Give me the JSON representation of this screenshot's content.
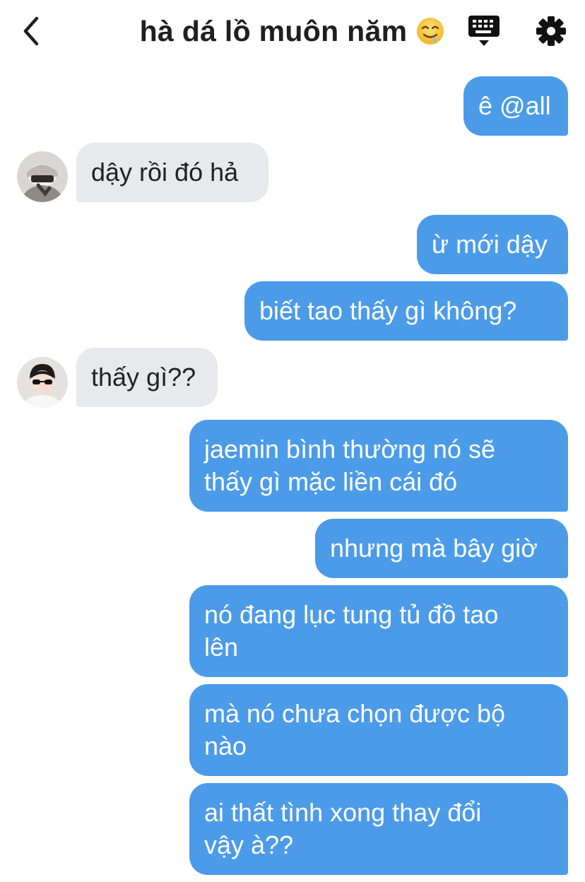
{
  "header": {
    "title": "hà dá lồ muôn năm",
    "title_emoji": "drooling-face-emoji",
    "back_icon": "chevron-left-icon",
    "keyboard_icon": "keyboard-icon",
    "settings_icon": "gear-icon"
  },
  "colors": {
    "outgoing_bubble": "#4b9be9",
    "incoming_bubble": "#e7e9ec",
    "title_text": "#1f1f1f"
  },
  "messages": [
    {
      "direction": "out",
      "text": "ê @all"
    },
    {
      "direction": "in",
      "avatar": "avatar-user-1",
      "text": "dậy rồi đó hả"
    },
    {
      "direction": "out",
      "text": "ừ mới dậy"
    },
    {
      "direction": "out",
      "text": "biết tao thấy gì không?"
    },
    {
      "direction": "in",
      "avatar": "avatar-user-2",
      "text": "thấy gì??"
    },
    {
      "direction": "out",
      "text": "jaemin bình thường nó sẽ\nthấy gì mặc liền cái đó"
    },
    {
      "direction": "out",
      "text": "nhưng mà bây giờ"
    },
    {
      "direction": "out",
      "text": "nó đang lục tung tủ đồ tao\nlên"
    },
    {
      "direction": "out",
      "text": "mà nó chưa chọn được bộ\nnào"
    },
    {
      "direction": "out",
      "text": "ai thất tình xong thay đổi\nvậy à??"
    }
  ]
}
